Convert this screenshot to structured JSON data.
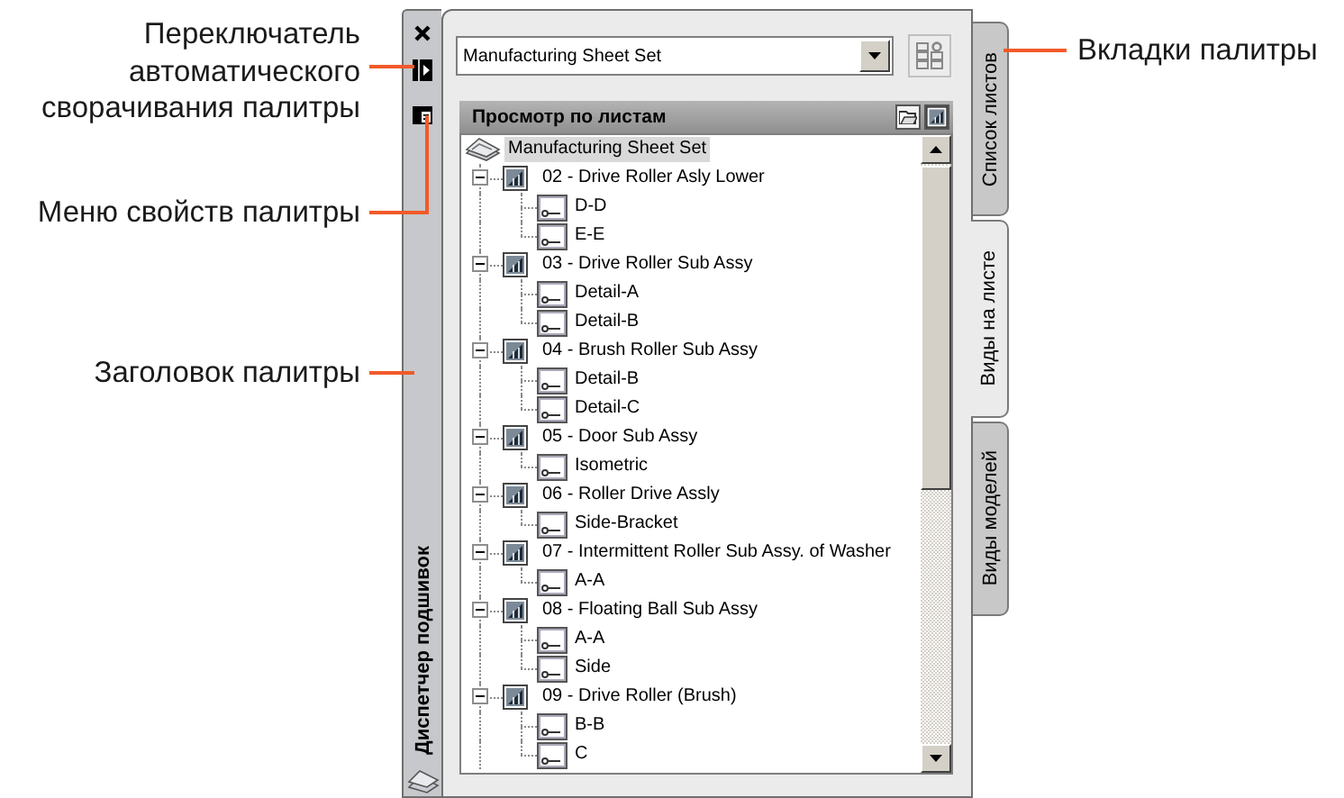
{
  "callouts": [
    {
      "kind": "left",
      "text": "Переключатель\nавтоматического\nсворачивания палитры"
    },
    {
      "kind": "left",
      "text": "Меню свойств палитры"
    },
    {
      "kind": "left",
      "text": "Заголовок палитры"
    },
    {
      "kind": "right",
      "text": "Вкладки палитры"
    }
  ],
  "palette": {
    "title": "Диспетчер подшивок",
    "sheet_set_dropdown": {
      "value": "Manufacturing Sheet Set"
    },
    "panel_header": "Просмотр по листам",
    "tree": {
      "label": "Manufacturing Sheet Set",
      "kind": "sheet_set",
      "selected": true,
      "children": [
        {
          "label": "02 - Drive Roller Asly Lower",
          "kind": "sheet",
          "selected": false,
          "expanded": true,
          "children": [
            {
              "label": "D-D",
              "kind": "view",
              "selected": false
            },
            {
              "label": "E-E",
              "kind": "view",
              "selected": false
            }
          ]
        },
        {
          "label": "03 - Drive Roller Sub Assy",
          "kind": "sheet",
          "selected": false,
          "expanded": true,
          "children": [
            {
              "label": "Detail-A",
              "kind": "view",
              "selected": false
            },
            {
              "label": "Detail-B",
              "kind": "view",
              "selected": false
            }
          ]
        },
        {
          "label": "04 - Brush Roller Sub Assy",
          "kind": "sheet",
          "selected": false,
          "expanded": true,
          "children": [
            {
              "label": "Detail-B",
              "kind": "view",
              "selected": false
            },
            {
              "label": "Detail-C",
              "kind": "view",
              "selected": false
            }
          ]
        },
        {
          "label": "05 - Door Sub Assy",
          "kind": "sheet",
          "selected": false,
          "expanded": true,
          "children": [
            {
              "label": "Isometric",
              "kind": "view",
              "selected": false
            }
          ]
        },
        {
          "label": "06 - Roller Drive Assly",
          "kind": "sheet",
          "selected": false,
          "expanded": true,
          "children": [
            {
              "label": "Side-Bracket",
              "kind": "view",
              "selected": false
            }
          ]
        },
        {
          "label": "07 - Intermittent Roller Sub Assy. of Washer",
          "kind": "sheet",
          "selected": false,
          "expanded": true,
          "children": [
            {
              "label": "A-A",
              "kind": "view",
              "selected": false
            }
          ]
        },
        {
          "label": "08 - Floating Ball Sub Assy",
          "kind": "sheet",
          "selected": false,
          "expanded": true,
          "children": [
            {
              "label": "A-A",
              "kind": "view",
              "selected": false
            },
            {
              "label": "Side",
              "kind": "view",
              "selected": false
            }
          ]
        },
        {
          "label": "09 - Drive Roller (Brush)",
          "kind": "sheet",
          "selected": false,
          "expanded": true,
          "children": [
            {
              "label": "B-B",
              "kind": "view",
              "selected": false
            },
            {
              "label": "C",
              "kind": "view",
              "selected": false
            }
          ]
        }
      ]
    },
    "tabs": [
      {
        "label": "Список листов",
        "selected": false
      },
      {
        "label": "Виды на листе",
        "selected": true
      },
      {
        "label": "Виды моделей",
        "selected": false
      }
    ]
  }
}
